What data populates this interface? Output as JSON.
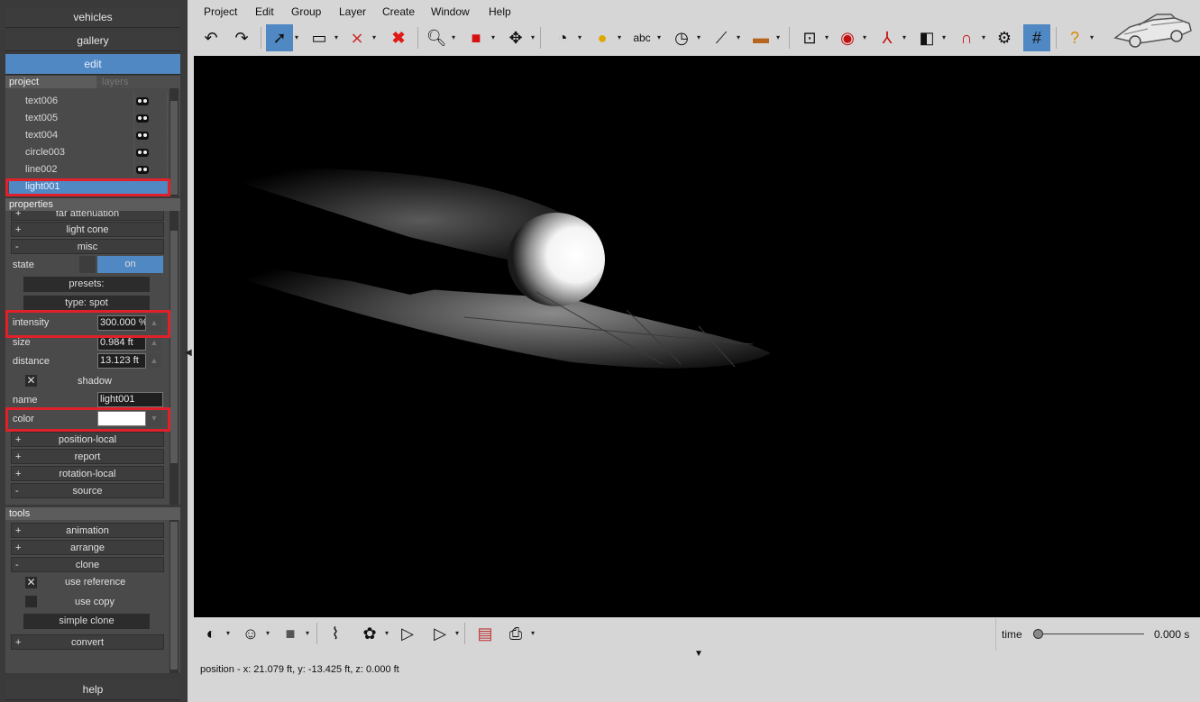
{
  "nav": {
    "vehicles": "vehicles",
    "gallery": "gallery",
    "edit": "edit",
    "help": "help"
  },
  "project_panel": {
    "tab_project": "project",
    "tab_layers": "layers",
    "items": [
      {
        "label": "text006"
      },
      {
        "label": "text005"
      },
      {
        "label": "text004"
      },
      {
        "label": "circle003"
      },
      {
        "label": "line002"
      },
      {
        "label": "light001"
      }
    ],
    "selected": "light001"
  },
  "properties": {
    "header": "properties",
    "far_attenuation": "far attenuation",
    "light_cone": "light cone",
    "misc": "misc",
    "state_label": "state",
    "state_value": "on",
    "presets": "presets:",
    "type": "type: spot",
    "intensity_label": "intensity",
    "intensity_value": "300.000 %",
    "size_label": "size",
    "size_value": "0.984 ft",
    "distance_label": "distance",
    "distance_value": "13.123 ft",
    "shadow_label": "shadow",
    "name_label": "name",
    "name_value": "light001",
    "color_label": "color",
    "color_value": "#ffffff",
    "position_local": "position-local",
    "report": "report",
    "rotation_local": "rotation-local",
    "source": "source",
    "plus": "+",
    "minus": "-"
  },
  "tools": {
    "header": "tools",
    "animation": "animation",
    "arrange": "arrange",
    "clone": "clone",
    "use_reference": "use reference",
    "use_copy": "use copy",
    "simple_clone": "simple clone",
    "convert": "convert"
  },
  "menu": [
    "Project",
    "Edit",
    "Group",
    "Layer",
    "Create",
    "Window",
    "Help"
  ],
  "toolbar_text": {
    "abc": "abc"
  },
  "timeline": {
    "label": "time",
    "value": "0.000 s"
  },
  "status": "position - x: 21.079 ft, y: -13.425 ft, z: 0.000 ft"
}
